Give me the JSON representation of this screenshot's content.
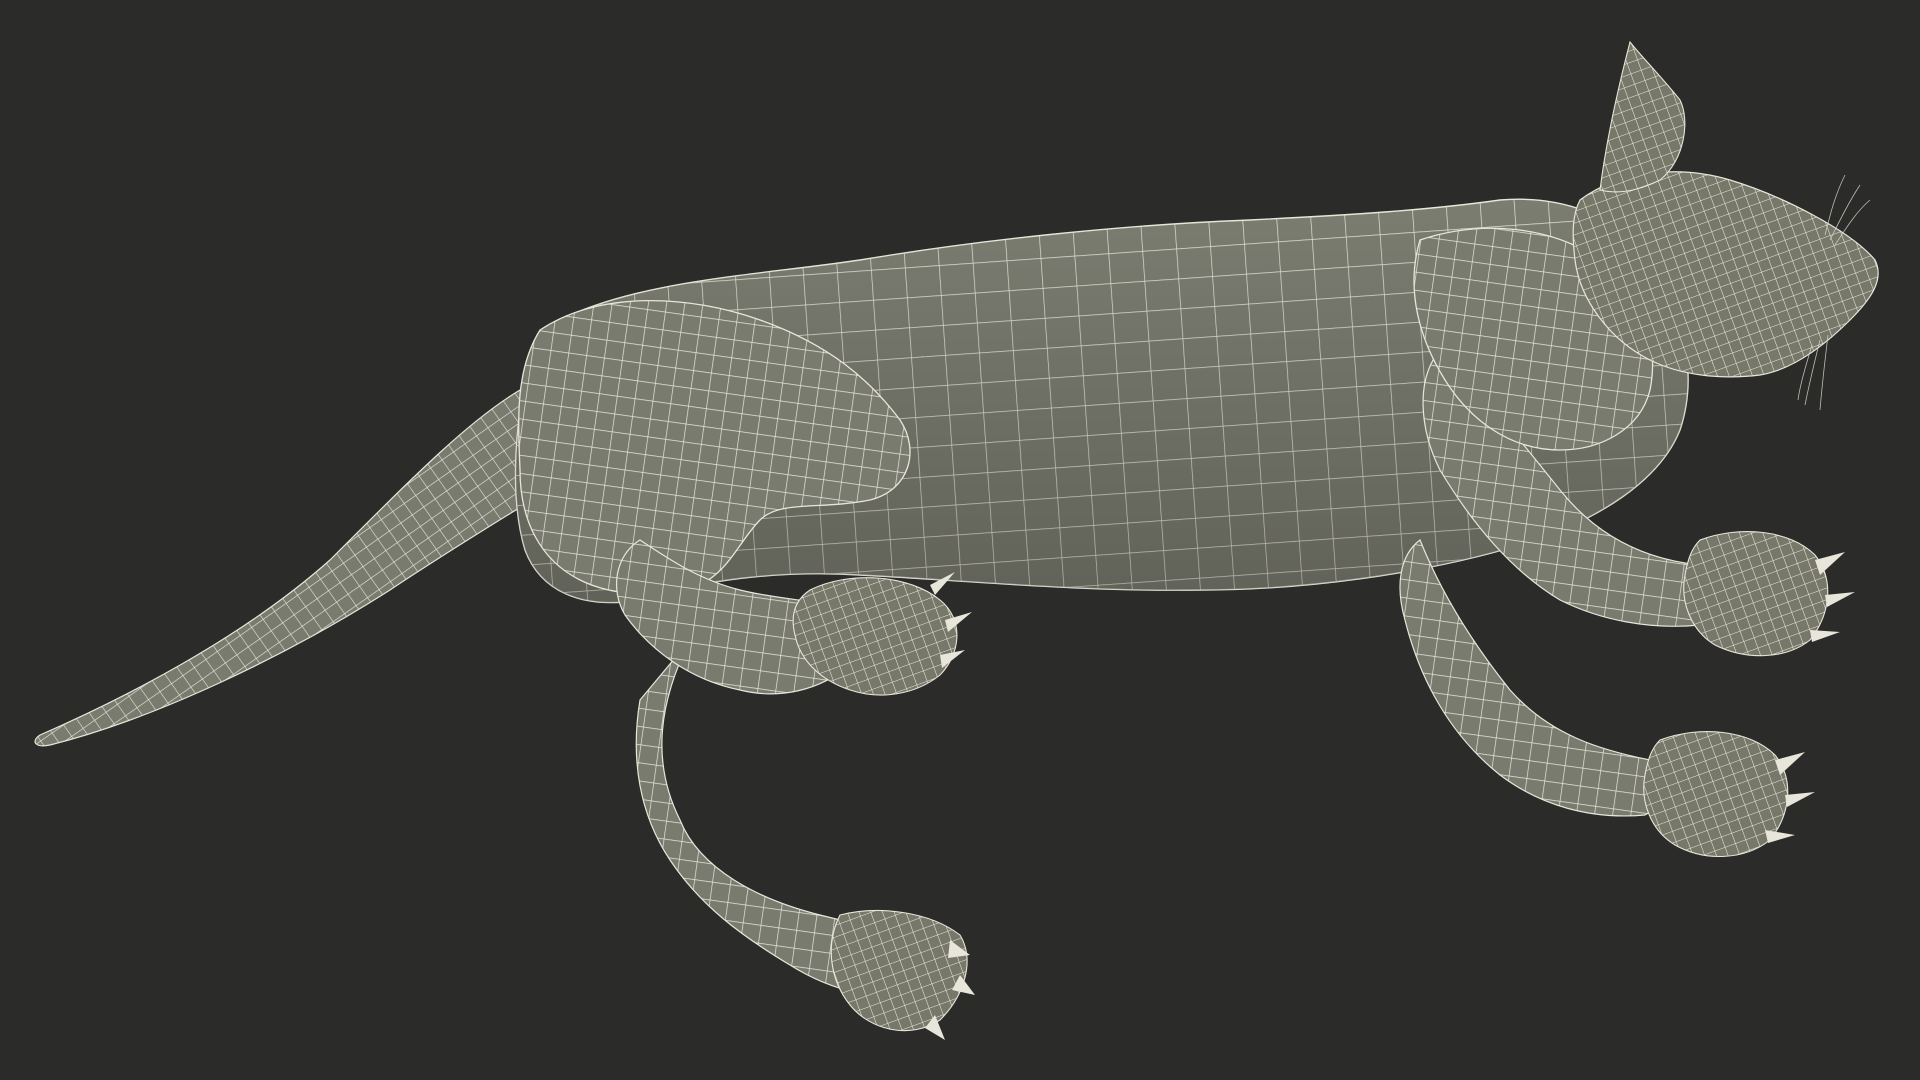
{
  "scene": {
    "background_color": "#2b2b29",
    "mesh_fill_color": "#7a7b6f",
    "mesh_shade_color": "#686a5f",
    "wire_color": "#e8e6da",
    "subject": "wireframe-cat-lying-on-side"
  }
}
